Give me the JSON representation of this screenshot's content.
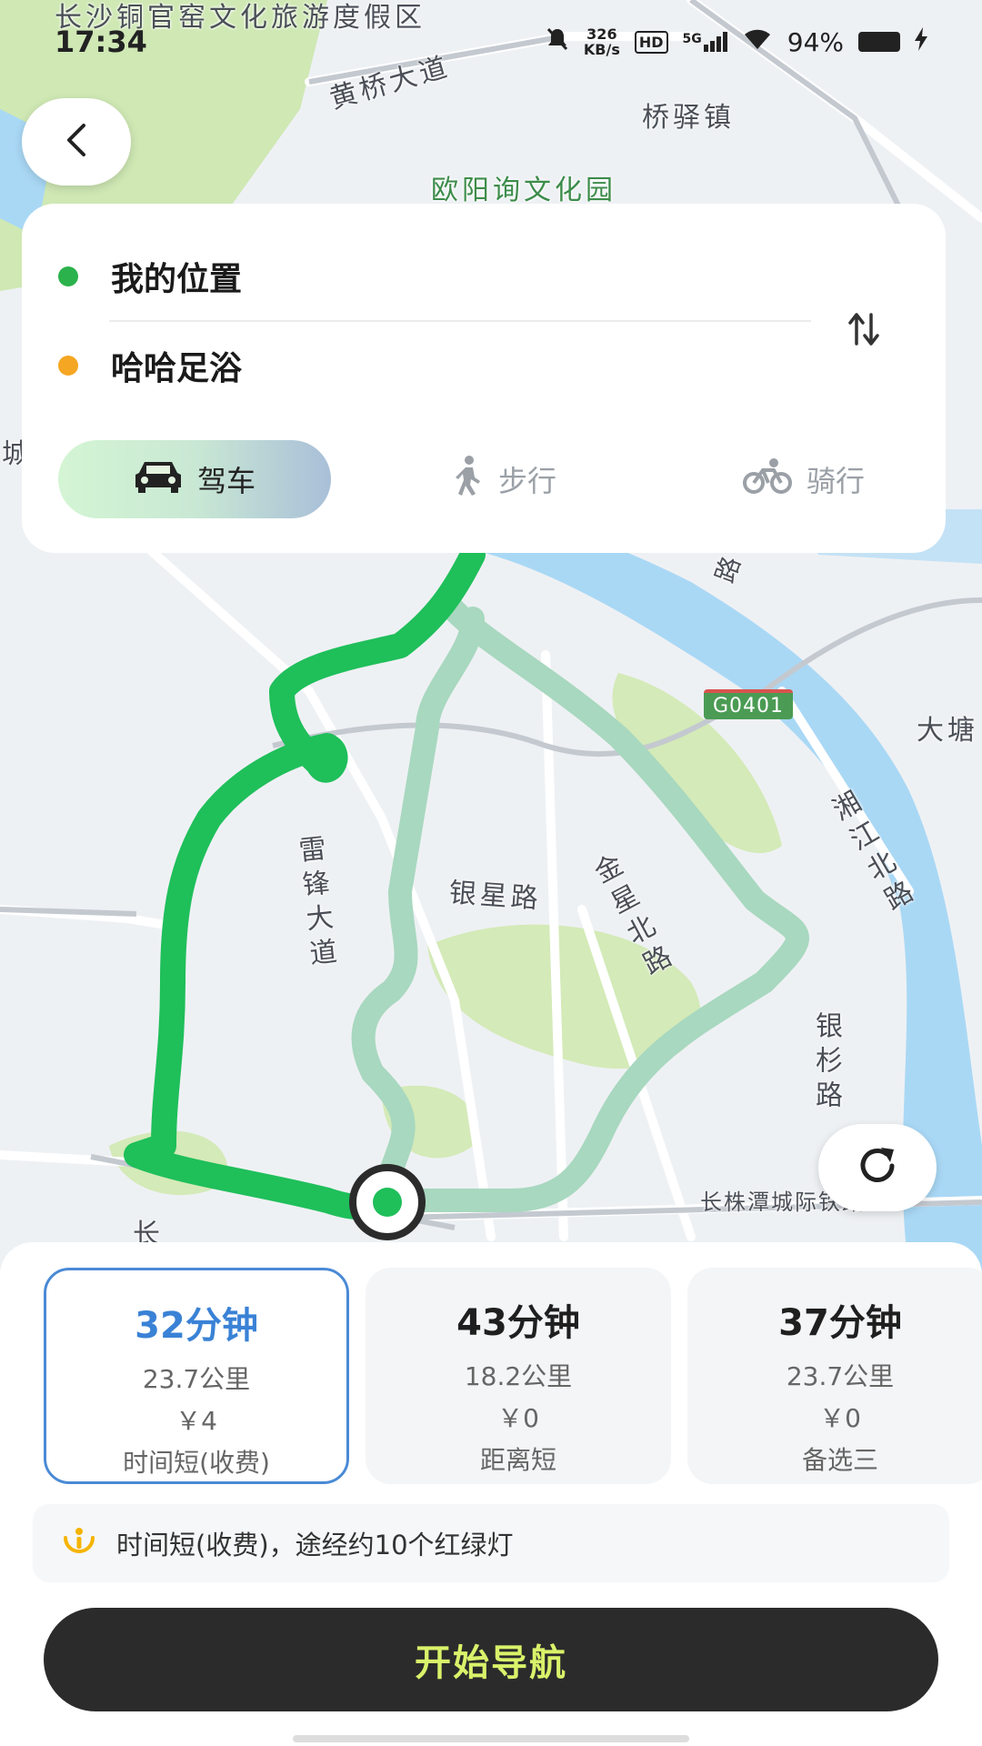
{
  "status_bar": {
    "time": "17:34",
    "net_speed_value": "326",
    "net_speed_unit": "KB/s",
    "hd": "HD",
    "signal": "5G",
    "battery": "94%"
  },
  "map": {
    "labels": {
      "poi_top_left": "长沙铜官窑文化旅游度假区",
      "huangqiao_road": "黄桥大道",
      "qiaoyi_town": "桥驿镇",
      "ouyang_park": "欧阳询文化园",
      "dadang": "大塘",
      "highway": "G0401",
      "xiangjiang_north": "湘江北路",
      "leifeng_road": "雷锋大道",
      "yinxing_road": "银星路",
      "jinxing_north": "金星北路",
      "yinshan_road": "银杉路",
      "changzhutan": "长株潭城际铁路",
      "lu_fragment": "路",
      "chang_fragment": "长",
      "cheng_fragment": "城"
    }
  },
  "route_card": {
    "origin": "我的位置",
    "destination": "哈哈足浴",
    "modes": [
      {
        "label": "驾车",
        "icon": "car-icon",
        "active": true
      },
      {
        "label": "步行",
        "icon": "walk-icon",
        "active": false
      },
      {
        "label": "骑行",
        "icon": "bike-icon",
        "active": false
      }
    ]
  },
  "route_options": [
    {
      "time": "32分钟",
      "distance": "23.7公里",
      "cost": "￥4",
      "tag": "时间短(收费)",
      "selected": true
    },
    {
      "time": "43分钟",
      "distance": "18.2公里",
      "cost": "￥0",
      "tag": "距离短",
      "selected": false
    },
    {
      "time": "37分钟",
      "distance": "23.7公里",
      "cost": "￥0",
      "tag": "备选三",
      "selected": false
    }
  ],
  "tip": "时间短(收费)，途经约10个红绿灯",
  "start_nav_label": "开始导航",
  "colors": {
    "route_primary": "#1fbf5a",
    "route_alt": "#a8d8bf",
    "river": "#a9d8f5",
    "accent_blue": "#3a82d6",
    "nav_button_text": "#d9f26a"
  }
}
